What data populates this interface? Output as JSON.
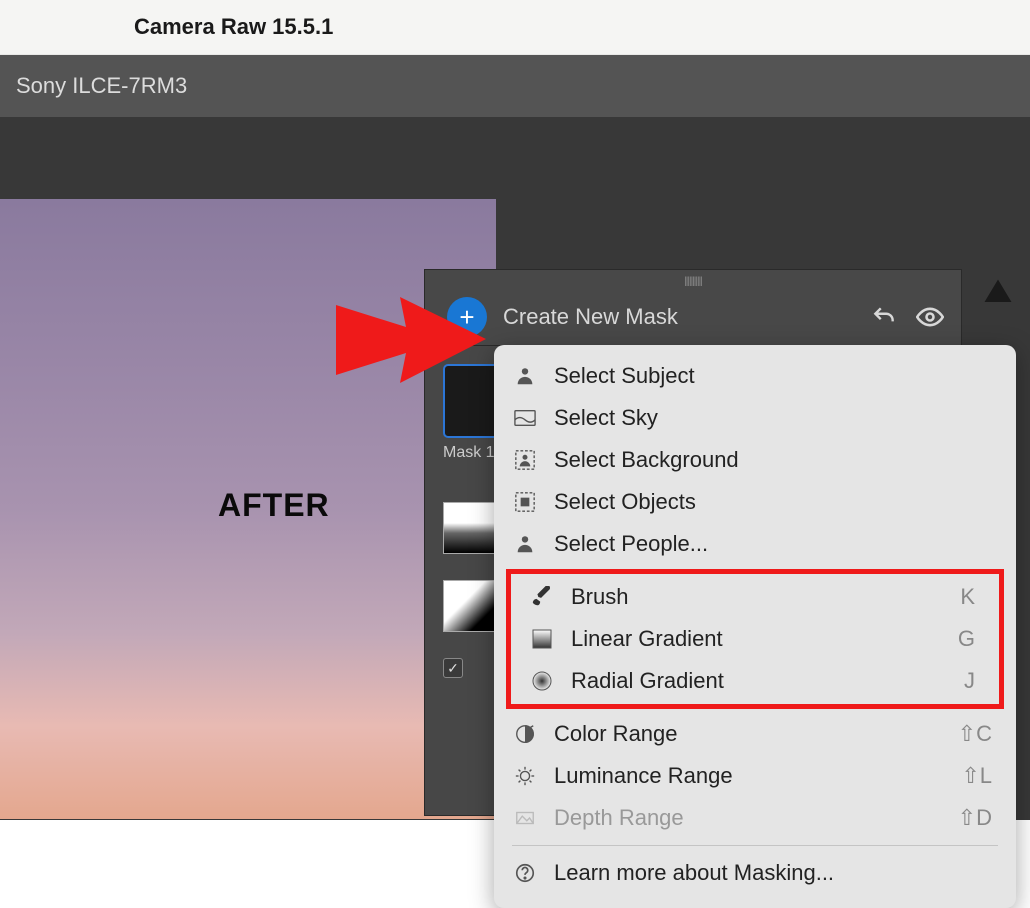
{
  "app": {
    "title": "Camera Raw 15.5.1"
  },
  "camera": {
    "model": "Sony ILCE-7RM3"
  },
  "annotation": {
    "after": "AFTER"
  },
  "masking": {
    "create_label": "Create New Mask",
    "mask1_caption": "Mask 1"
  },
  "menu": {
    "select_subject": "Select Subject",
    "select_sky": "Select Sky",
    "select_background": "Select Background",
    "select_objects": "Select Objects",
    "select_people": "Select People...",
    "brush": "Brush",
    "brush_key": "K",
    "linear_gradient": "Linear Gradient",
    "linear_key": "G",
    "radial_gradient": "Radial Gradient",
    "radial_key": "J",
    "color_range": "Color Range",
    "color_key": "⇧C",
    "luminance_range": "Luminance Range",
    "luminance_key": "⇧L",
    "depth_range": "Depth Range",
    "depth_key": "⇧D",
    "learn_more": "Learn more about Masking..."
  }
}
